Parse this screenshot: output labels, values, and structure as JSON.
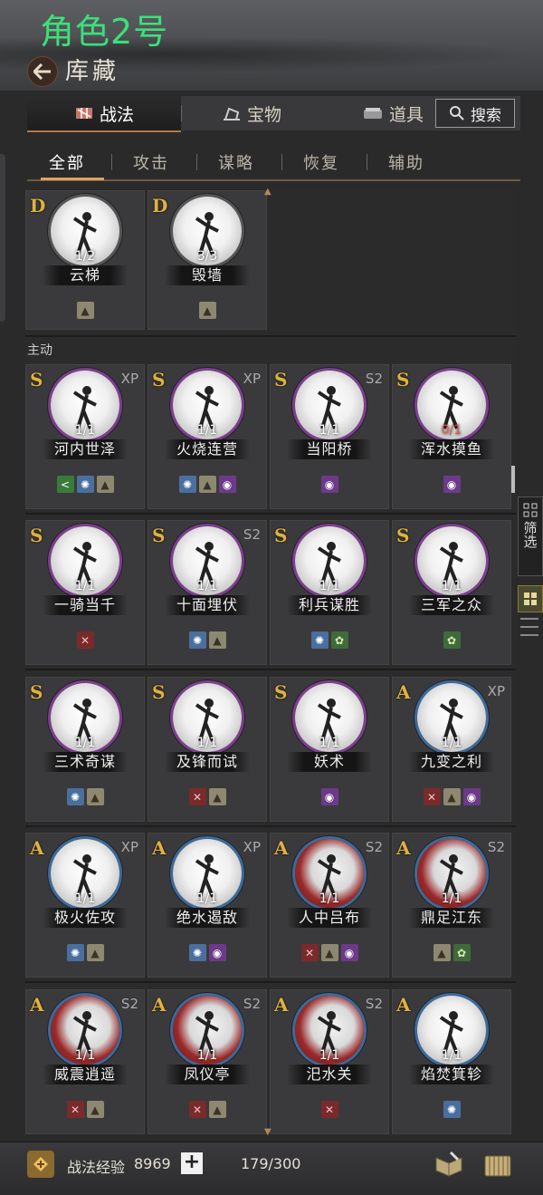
{
  "header": {
    "role_title": "角色2号",
    "page_title": "库藏"
  },
  "top_tabs": {
    "zhanfa": "战法",
    "baowu": "宝物",
    "daoju": "道具",
    "search": "搜索"
  },
  "sub_tabs": [
    "全部",
    "攻击",
    "谋略",
    "恢复",
    "辅助"
  ],
  "section_label": "主动",
  "cards_top": [
    {
      "grade": "D",
      "count": "1/2",
      "name": "云梯"
    },
    {
      "grade": "D",
      "count": "3/3",
      "name": "毁墙"
    }
  ],
  "cards": [
    {
      "grade": "S",
      "tag": "XP",
      "count": "1/1",
      "name": "河内世泽"
    },
    {
      "grade": "S",
      "tag": "XP",
      "count": "1/1",
      "name": "火烧连营"
    },
    {
      "grade": "S",
      "tag": "S2",
      "count": "1/1",
      "name": "当阳桥"
    },
    {
      "grade": "S",
      "tag": "",
      "count": "0/1",
      "name": "浑水摸鱼"
    },
    {
      "grade": "S",
      "tag": "",
      "count": "1/1",
      "name": "一骑当千"
    },
    {
      "grade": "S",
      "tag": "S2",
      "count": "1/1",
      "name": "十面埋伏"
    },
    {
      "grade": "S",
      "tag": "",
      "count": "1/1",
      "name": "利兵谋胜"
    },
    {
      "grade": "S",
      "tag": "",
      "count": "1/1",
      "name": "三军之众"
    },
    {
      "grade": "S",
      "tag": "",
      "count": "1/1",
      "name": "三术奇谋"
    },
    {
      "grade": "S",
      "tag": "",
      "count": "1/1",
      "name": "及锋而试"
    },
    {
      "grade": "S",
      "tag": "",
      "count": "1/1",
      "name": "妖术"
    },
    {
      "grade": "A",
      "tag": "XP",
      "count": "1/1",
      "name": "九变之利"
    },
    {
      "grade": "A",
      "tag": "XP",
      "count": "1/1",
      "name": "极火佐攻"
    },
    {
      "grade": "A",
      "tag": "XP",
      "count": "1/1",
      "name": "绝水遏敌"
    },
    {
      "grade": "A",
      "tag": "S2",
      "count": "1/1",
      "name": "人中吕布"
    },
    {
      "grade": "A",
      "tag": "S2",
      "count": "1/1",
      "name": "鼎足江东"
    },
    {
      "grade": "A",
      "tag": "S2",
      "count": "1/1",
      "name": "威震逍遥"
    },
    {
      "grade": "A",
      "tag": "S2",
      "count": "1/1",
      "name": "凤仪亭"
    },
    {
      "grade": "A",
      "tag": "S2",
      "count": "1/1",
      "name": "汜水关"
    },
    {
      "grade": "A",
      "tag": "",
      "count": "1/1",
      "name": "焰焚箕轸"
    }
  ],
  "filter": {
    "label": "筛选"
  },
  "footer": {
    "exp_label": "战法经验",
    "exp_value": "8969",
    "add": "+",
    "capacity": "179/300"
  },
  "colors": {
    "role_title": "#3be07a",
    "grade": "#e0b23c",
    "accent": "#e0a25c"
  }
}
